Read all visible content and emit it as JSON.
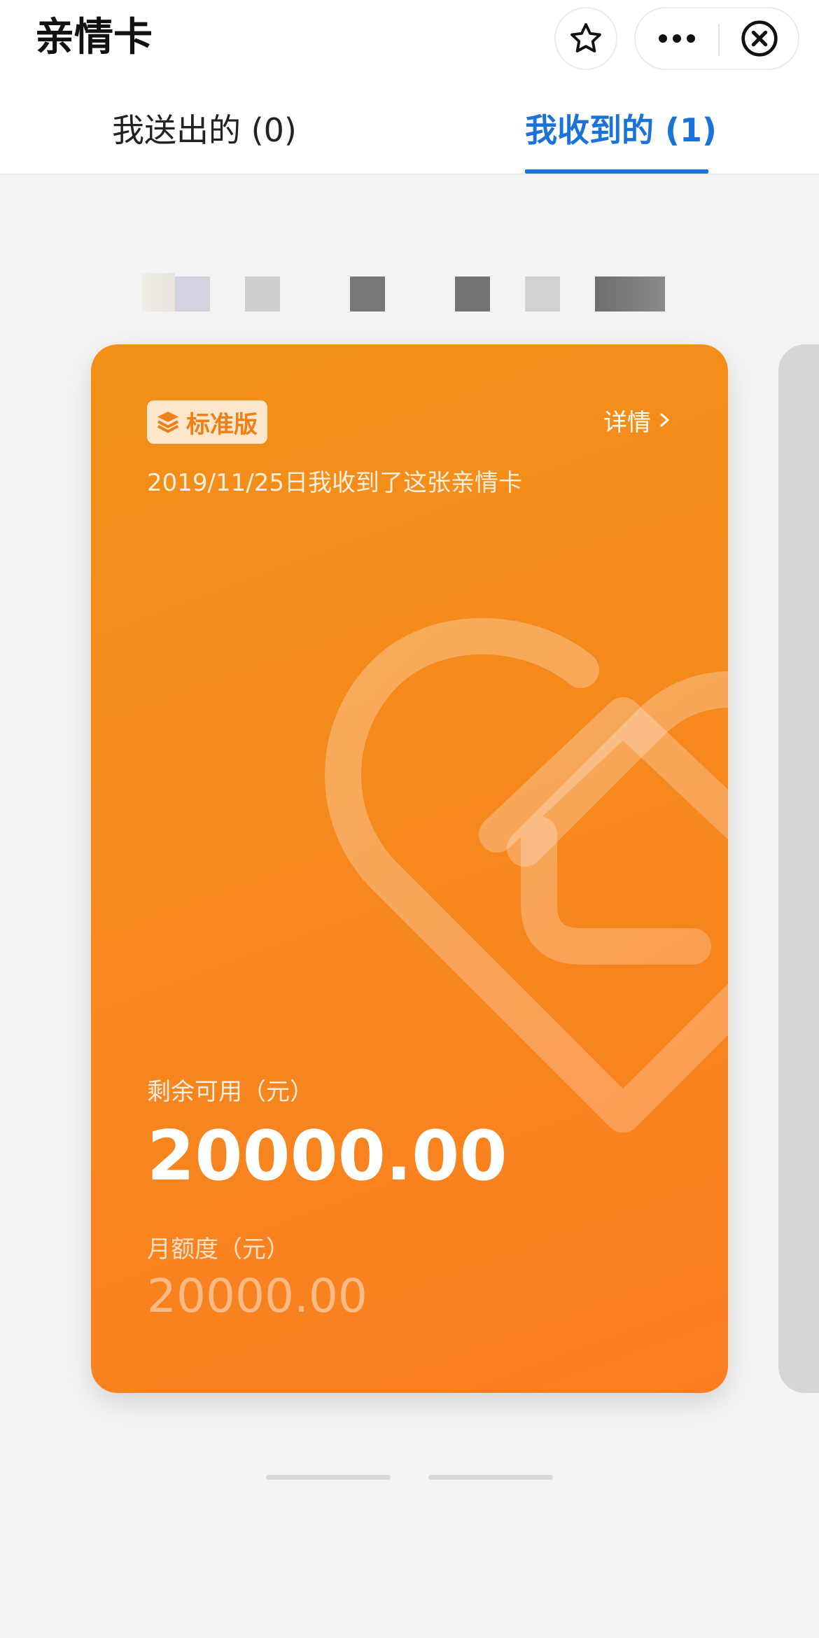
{
  "header": {
    "title": "亲情卡",
    "icons": {
      "star": "star-icon",
      "more": "more-dots-icon",
      "close": "close-circle-icon"
    }
  },
  "tabs": [
    {
      "label": "我送出的 (0)",
      "active": false
    },
    {
      "label": "我收到的 (1)",
      "active": true
    }
  ],
  "card": {
    "badge_icon": "layers-icon",
    "badge_label": "标准版",
    "detail_label": "详情",
    "detail_icon": "chevron-right-icon",
    "received_text": "2019/11/25日我收到了这张亲情卡",
    "remaining_label": "剩余可用（元）",
    "remaining_amount": "20000.00",
    "monthly_limit_label": "月额度（元）",
    "monthly_limit_amount": "20000.00",
    "background_icon": "heart-home-icon"
  },
  "colors": {
    "accent_blue": "#1a73d9",
    "card_orange_start": "#f29018",
    "card_orange_end": "#fa7d22",
    "badge_bg": "#fde7cc"
  }
}
